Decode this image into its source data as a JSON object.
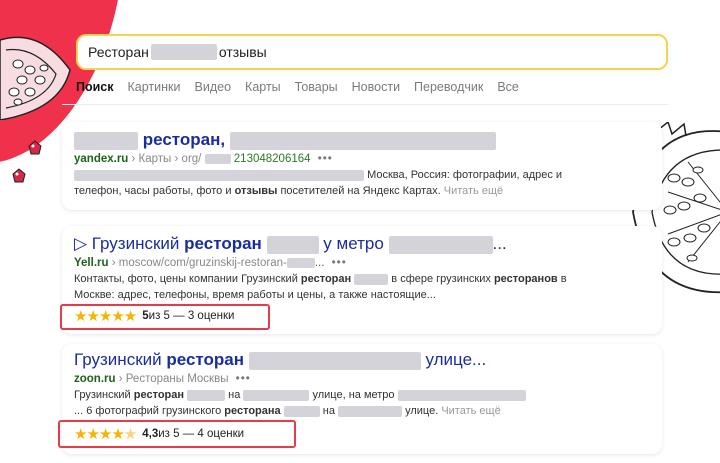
{
  "search": {
    "query_left": "Ресторан",
    "query_right": "отзывы"
  },
  "tabs": [
    "Поиск",
    "Картинки",
    "Видео",
    "Карты",
    "Товары",
    "Новости",
    "Переводчик",
    "Все"
  ],
  "results": [
    {
      "title_bold": "ресторан,",
      "url_domain": "yandex.ru",
      "url_path": "› Карты › org/",
      "url_id": "213048206164",
      "snippet_line1_tail": "Москва, Россия: фотографии, адрес и",
      "snippet_line2_pre": "телефон, часы работы, фото и ",
      "snippet_line2_bold": "отзывы",
      "snippet_line2_post": " посетителей на Яндекс Картах.",
      "read_more": "Читать ещё"
    },
    {
      "title_prefix": "▷ Грузинский ",
      "title_bold": "ресторан",
      "title_mid": " у метро",
      "title_ellipsis": "...",
      "url_domain": "Yell.ru",
      "url_path": "› moscow/com/gruzinskij-restoran-",
      "url_ellipsis": "...",
      "snippet_line1_pre": "Контакты, фото, цены компании Грузинский ",
      "snippet_line1_bold": "ресторан",
      "snippet_line1_mid": " в сфере грузинских ",
      "snippet_line1_bold2": "ресторанов",
      "snippet_line1_post": " в",
      "snippet_line2": "Москве: адрес, телефоны, время работы и цены, а также настоящие...",
      "rating_value": "5",
      "rating_text": " из 5 — 3 оценки",
      "stars": 5
    },
    {
      "title_prefix": "Грузинский ",
      "title_bold": "ресторан",
      "title_suffix": " улице...",
      "url_domain": "zoon.ru",
      "url_path": "› Рестораны Москвы",
      "snippet_line1_pre": "Грузинский ",
      "snippet_line1_bold": "ресторан",
      "snippet_line1_mid": " на",
      "snippet_line1_mid2": " улице, на метро",
      "snippet_line2_pre": "... 6 фотографий грузинского ",
      "snippet_line2_bold": "ресторана",
      "snippet_line2_mid": " на",
      "snippet_line2_post": " улице.",
      "read_more": "Читать ещё",
      "rating_value": "4,3",
      "rating_text": " из 5 — 4 оценки",
      "stars": 4.3
    }
  ],
  "colors": {
    "accent_red": "#f0314b",
    "link": "#1a2da0",
    "url_green": "#2c7a25",
    "star": "#f4b400",
    "highlight_box": "#e63b48",
    "search_border": "#f5d34a"
  },
  "decor": {
    "left": "pomegranate-slice-icon",
    "right": "pomegranate-half-icon",
    "seeds": "pomegranate-seed-icon"
  }
}
